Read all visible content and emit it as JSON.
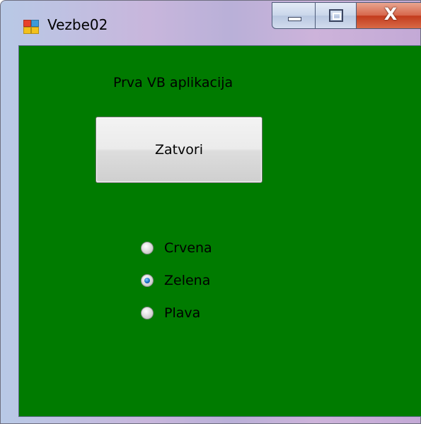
{
  "window": {
    "title": "Vezbe02",
    "client_background": "#007b00",
    "icon": "windows-form-icon",
    "buttons": {
      "minimize_icon": "minimize-icon",
      "maximize_icon": "maximize-icon",
      "close_label": "X"
    }
  },
  "form": {
    "label_text": "Prva VB aplikacija",
    "close_button_label": "Zatvori",
    "radio_options": [
      {
        "label": "Crvena",
        "checked": false
      },
      {
        "label": "Zelena",
        "checked": true
      },
      {
        "label": "Plava",
        "checked": false
      }
    ]
  }
}
